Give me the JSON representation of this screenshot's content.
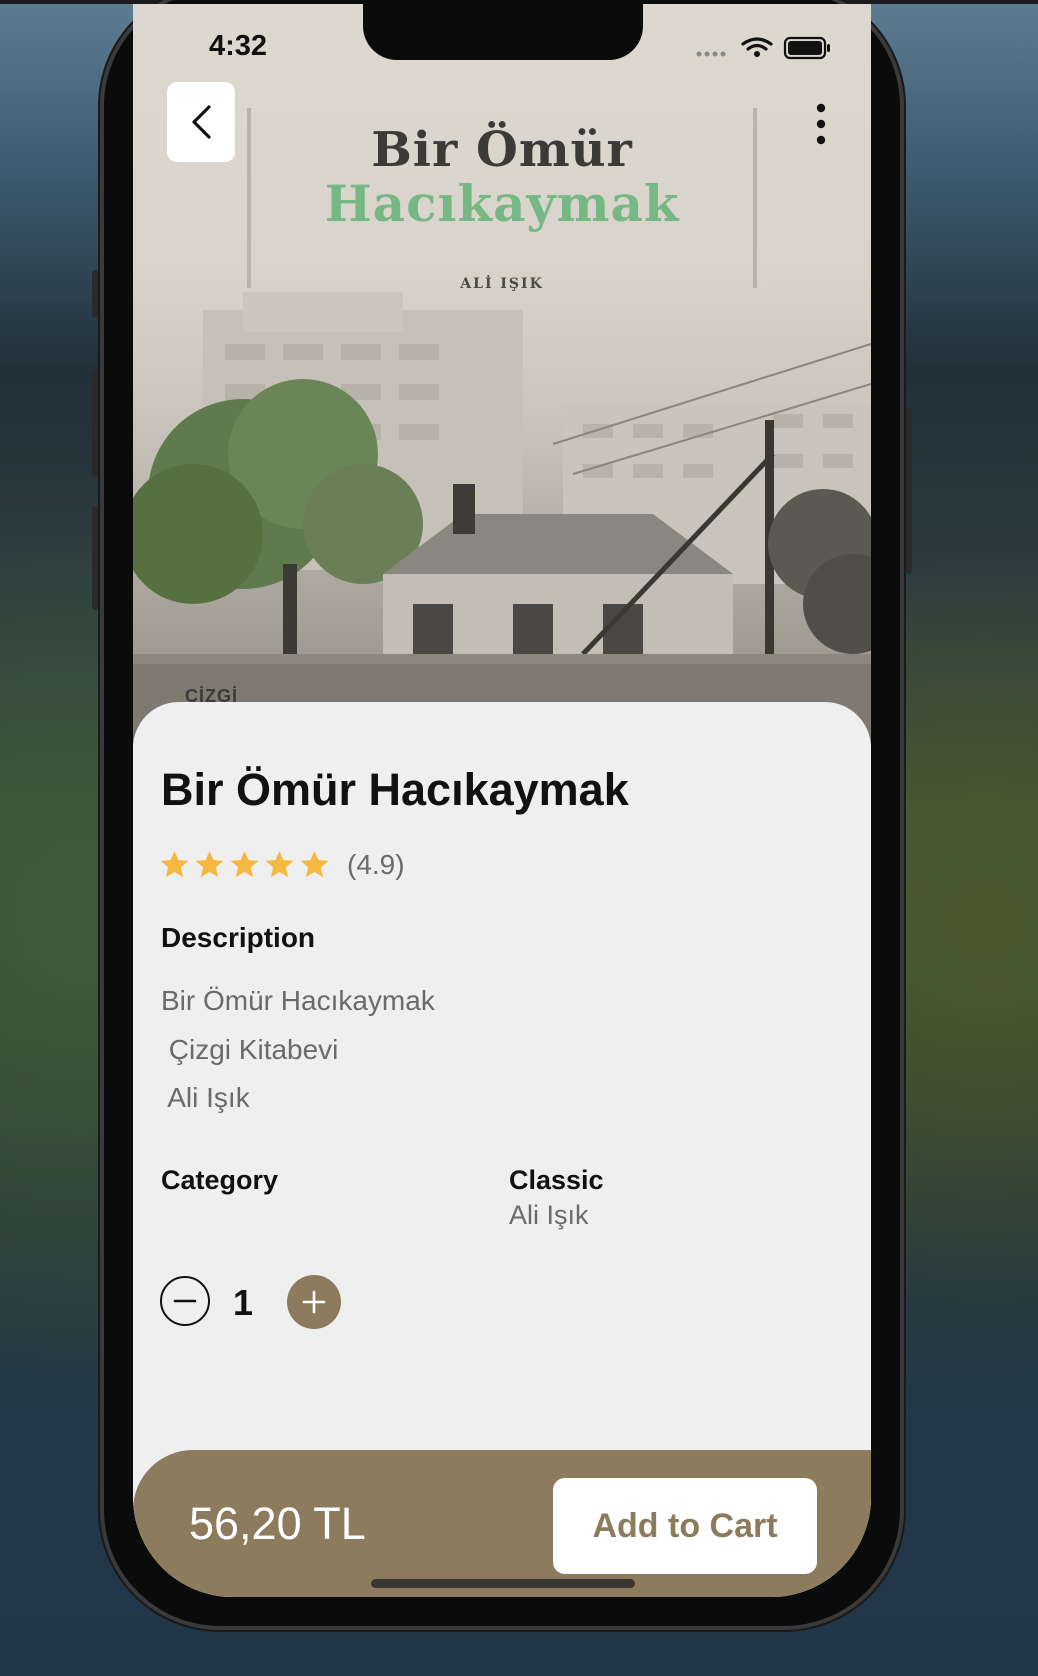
{
  "status_bar": {
    "time": "4:32"
  },
  "cover": {
    "title_line1": "Bir Ömür",
    "title_line2": "Hacıkaymak",
    "author": "ALİ IŞIK",
    "publisher": "ÇİZGİ"
  },
  "header": {
    "back_icon": "chevron-left-icon",
    "menu_icon": "more-vertical-icon"
  },
  "product": {
    "title": "Bir Ömür Hacıkaymak",
    "rating_stars": 5,
    "rating_text": "(4.9)",
    "star_color": "#f5b942",
    "description_heading": "Description",
    "description_lines": [
      "Bir Ömür Hacıkaymak",
      " Çizgi Kitabevi",
      " Ali Işık"
    ],
    "category_heading": "Category",
    "category_value": "Classic",
    "category_sub": "Ali Işık"
  },
  "quantity": {
    "value": "1",
    "minus_icon": "minus-icon",
    "plus_icon": "plus-icon"
  },
  "footer": {
    "price": "56,20 TL",
    "add_to_cart_label": "Add to Cart",
    "accent_color": "#8d7b5d"
  }
}
